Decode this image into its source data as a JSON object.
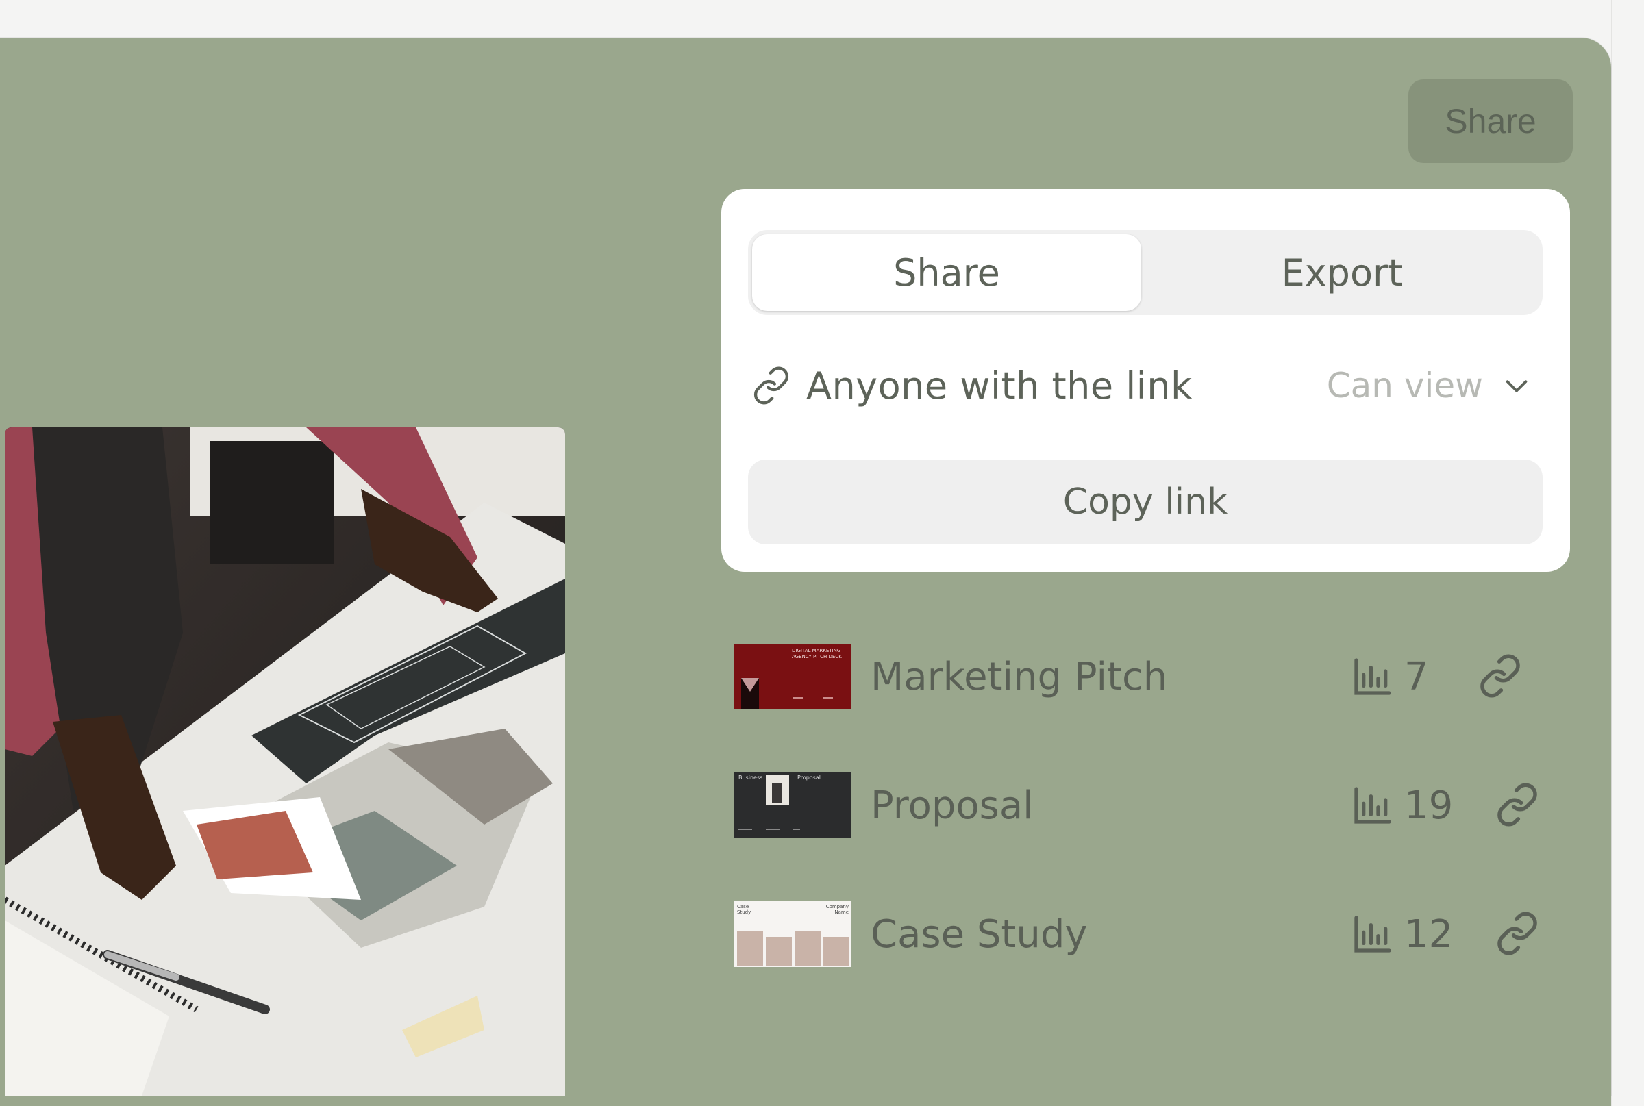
{
  "header": {
    "share_button": "Share"
  },
  "popover": {
    "tabs": [
      {
        "label": "Share",
        "active": true
      },
      {
        "label": "Export",
        "active": false
      }
    ],
    "access": {
      "icon": "link-icon",
      "label": "Anyone with the link",
      "permission": "Can view"
    },
    "copy_button": "Copy link"
  },
  "files": [
    {
      "name": "Marketing Pitch",
      "views": "7",
      "thumb_text": "DIGITAL MARKETING AGENCY PITCH DECK"
    },
    {
      "name": "Proposal",
      "views": "19",
      "thumb_text_left": "Business",
      "thumb_text_right": "Proposal"
    },
    {
      "name": "Case Study",
      "views": "12",
      "thumb_text_left": "Case Study",
      "thumb_text_right": "Company Name"
    }
  ],
  "colors": {
    "background": "#9aa78d",
    "button": "#87937b",
    "card": "#ffffff",
    "marketing_thumb": "#7a1012",
    "proposal_thumb": "#2b2c2d",
    "case_thumb": "#c9b3a8"
  }
}
